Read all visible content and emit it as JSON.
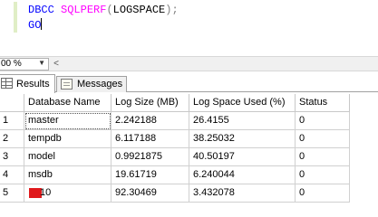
{
  "editor": {
    "line1": {
      "keyword": "DBCC",
      "function": "SQLPERF",
      "open": "(",
      "argument": "LOGSPACE",
      "close": ");"
    },
    "line2": {
      "keyword": "GO"
    }
  },
  "zoom": {
    "value": "00 %"
  },
  "tabs": [
    {
      "label": "Results",
      "icon": "grid-icon",
      "selected": true
    },
    {
      "label": "Messages",
      "icon": "messages-icon",
      "selected": false
    }
  ],
  "grid": {
    "columns": [
      "",
      "Database Name",
      "Log Size (MB)",
      "Log Space Used (%)",
      "Status"
    ],
    "rows": [
      {
        "num": "1",
        "name": "master",
        "log_size": "2.242188",
        "log_space_used": "26.4155",
        "status": "0"
      },
      {
        "num": "2",
        "name": "tempdb",
        "log_size": "6.117188",
        "log_space_used": "38.25032",
        "status": "0"
      },
      {
        "num": "3",
        "name": "model",
        "log_size": "0.9921875",
        "log_space_used": "40.50197",
        "status": "0"
      },
      {
        "num": "4",
        "name": "msdb",
        "log_size": "19.61719",
        "log_space_used": "6.240044",
        "status": "0"
      },
      {
        "num": "5",
        "name": "10",
        "log_size": "92.30469",
        "log_space_used": "3.432078",
        "status": "0"
      }
    ]
  },
  "colors": {
    "keyword": "#0000ff",
    "function": "#ff00ff",
    "punctuation": "#808080",
    "redaction": "#e0191c"
  }
}
